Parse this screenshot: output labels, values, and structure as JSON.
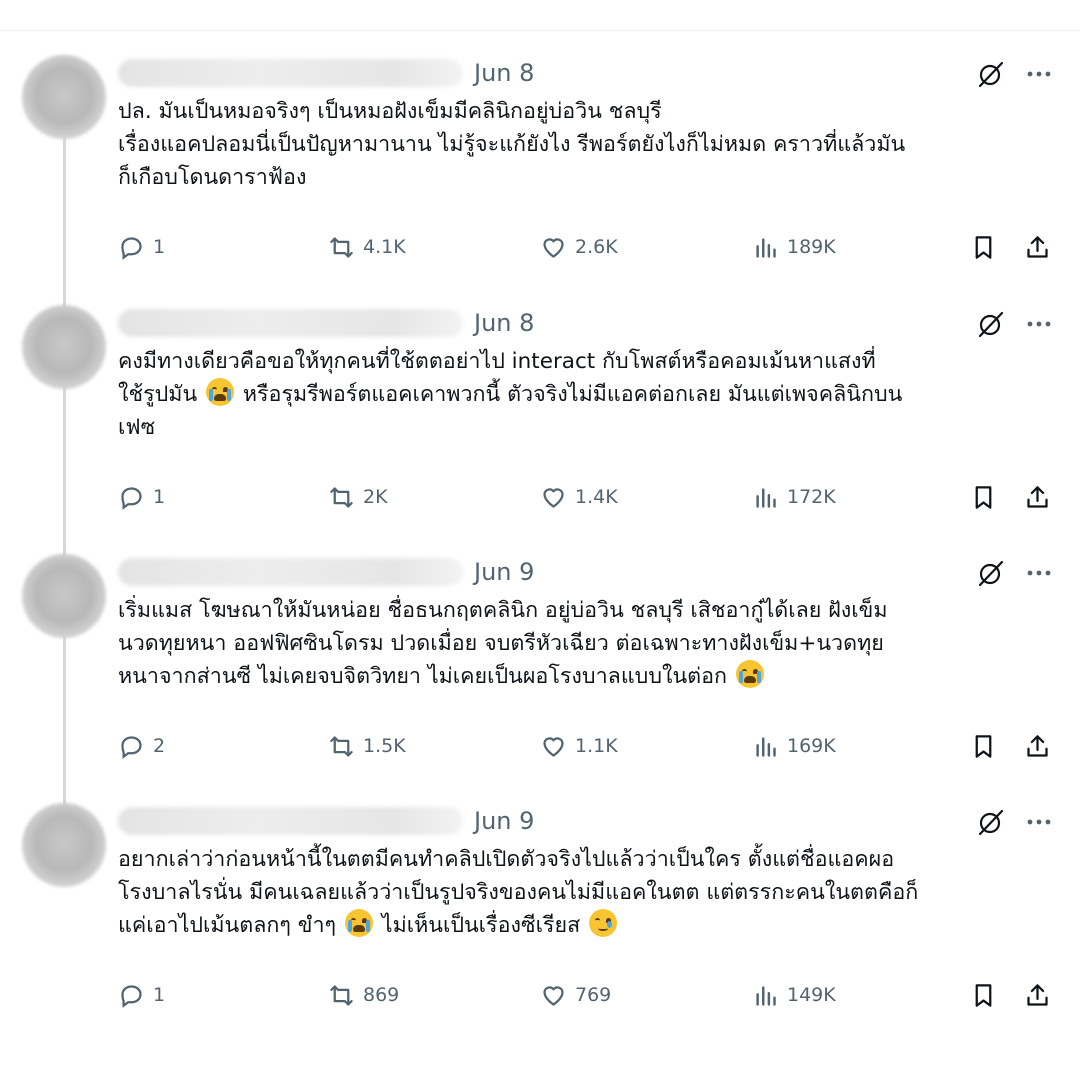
{
  "posts": [
    {
      "date": "Jun 8",
      "text": "ปล. มันเป็นหมอจริงๆ เป็นหมอฝังเข็มมีคลินิกอยู่บ่อวิน ชลบุรี\nเรื่องแอคปลอมนี่เป็นปัญหามานาน ไม่รู้จะแก้ยังไง รีพอร์ตยังไงก็ไม่หมด คราวที่แล้วมัน\nก็เกือบโดนดาราฟ้อง",
      "replies": "1",
      "reposts": "4.1K",
      "likes": "2.6K",
      "views": "189K"
    },
    {
      "date": "Jun 8",
      "text_a": "คงมีทางเดียวคือขอให้ทุกคนที่ใช้ตตอย่าไป interact กับโพสต์หรือคอมเม้นหาแสงที่\nใช้รูปมัน ",
      "text_b": " หรือรุมรีพอร์ตแอคเคาพวกนี้ ตัวจริงไม่มีแอคต่อกเลย มันแต่เพจคลินิกบน\nเฟซ",
      "replies": "1",
      "reposts": "2K",
      "likes": "1.4K",
      "views": "172K"
    },
    {
      "date": "Jun 9",
      "text_a": "เริ่มแมส โฆษณาให้มันหน่อย ชื่อธนกฤตคลินิก อยู่บ่อวิน ชลบุรี เสิชอากู๋ได้เลย ฝังเข็ม\nนวดทุยหนา ออฟฟิศซินโดรม ปวดเมื่อย จบตรีหัวเฉียว ต่อเฉพาะทางฝังเข็ม+นวดทุย\nหนาจากส่านซี ไม่เคยจบจิตวิทยา ไม่เคยเป็นผอโรงบาลแบบในต่อก ",
      "replies": "2",
      "reposts": "1.5K",
      "likes": "1.1K",
      "views": "169K"
    },
    {
      "date": "Jun 9",
      "text_a": "อยากเล่าว่าก่อนหน้านี้ในตตมีคนทำคลิปเปิดตัวจริงไปแล้วว่าเป็นใคร ตั้งแต่ชื่อแอคผอ\nโรงบาลไรนั่น มีคนเฉลยแล้วว่าเป็นรูปจริงของคนไม่มีแอคในตต แต่ตรรกะคนในตตคือก็\nแค่เอาไปเม้นตลกๆ ขำๆ ",
      "text_b": " ไม่เห็นเป็นเรื่องซีเรียส ",
      "replies": "1",
      "reposts": "869",
      "likes": "769",
      "views": "149K"
    }
  ],
  "icons": {
    "reply": "reply-icon",
    "repost": "repost-icon",
    "like": "like-icon",
    "views": "views-icon",
    "bookmark": "bookmark-icon",
    "share": "share-icon",
    "grok": "grok-icon",
    "more": "more-icon",
    "emoji_cry": "loudly-crying-face-emoji",
    "emoji_hold": "face-holding-back-tears-emoji"
  },
  "colors": {
    "text": "#0f1419",
    "muted": "#536471",
    "thread": "#cfd9de"
  }
}
